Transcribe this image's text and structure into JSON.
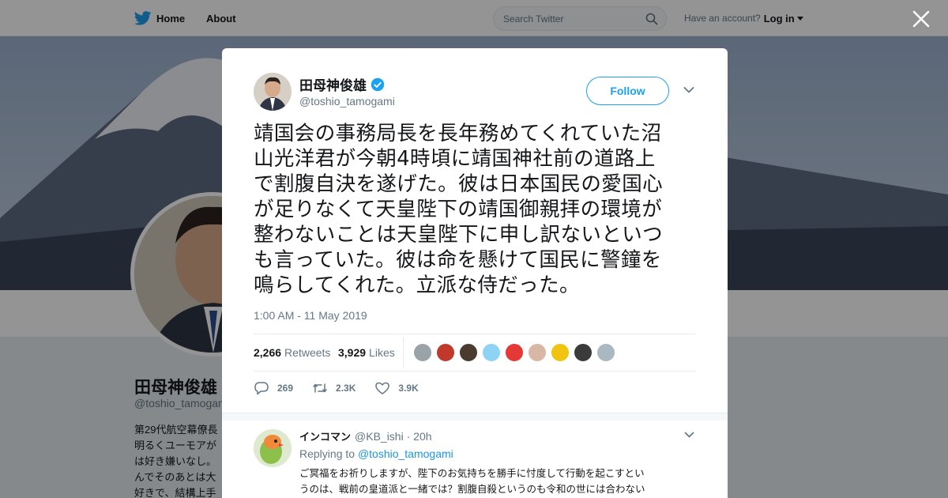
{
  "topnav": {
    "home_label": "Home",
    "about_label": "About",
    "search_placeholder": "Search Twitter",
    "account_prompt": "Have an account?",
    "login_label": "Log in"
  },
  "profile": {
    "name": "田母神俊雄",
    "handle": "@toshio_tamogami",
    "bio_lines": [
      "第29代航空幕僚長",
      "明るくユーモアが",
      "は好き嫌いなし。",
      "んでそのあとは大",
      "好きで、結構上手"
    ]
  },
  "tweet": {
    "author_name": "田母神俊雄",
    "author_handle": "@toshio_tamogami",
    "follow_label": "Follow",
    "text_lines": [
      "靖国会の事務局長を長年務めてくれていた沼",
      "山光洋君が今朝4時頃に靖国神社前の道路上",
      "で割腹自決を遂げた。彼は日本国民の愛国心",
      "が足りなくて天皇陛下の靖国御親拝の環境が",
      "整わないことは天皇陛下に申し訳ないといつ",
      "も言っていた。彼は命を懸けて国民に警鐘を",
      "鳴らしてくれた。立派な侍だった。"
    ],
    "timestamp": "1:00 AM - 11 May 2019",
    "retweets_count": "2,266",
    "retweets_label": "Retweets",
    "likes_count": "3,929",
    "likes_label": "Likes",
    "liker_colors": [
      "#9aa3a8",
      "#c0392b",
      "#4a3b2e",
      "#8fd3f4",
      "#e53935",
      "#d9b7a6",
      "#f1c40f",
      "#3b3b3b",
      "#aab8c2"
    ],
    "actions": {
      "replies": "269",
      "retweets": "2.3K",
      "likes": "3.9K"
    }
  },
  "reply": {
    "name": "インコマン",
    "handle": "@KB_ishi",
    "time": "20h",
    "replying_prefix": "Replying to",
    "replying_to": "@toshio_tamogami",
    "text_lines": [
      "ご冥福をお祈りしますが、陛下のお気持ちを勝手に忖度して行動を起こすとい",
      "うのは、戦前の皇道派と一緒では？割腹自殺というのも令和の世には合わない"
    ]
  },
  "colors": {
    "brand_blue": "#1da1f2",
    "link_blue": "#1b95e0",
    "muted_text": "#657786"
  }
}
